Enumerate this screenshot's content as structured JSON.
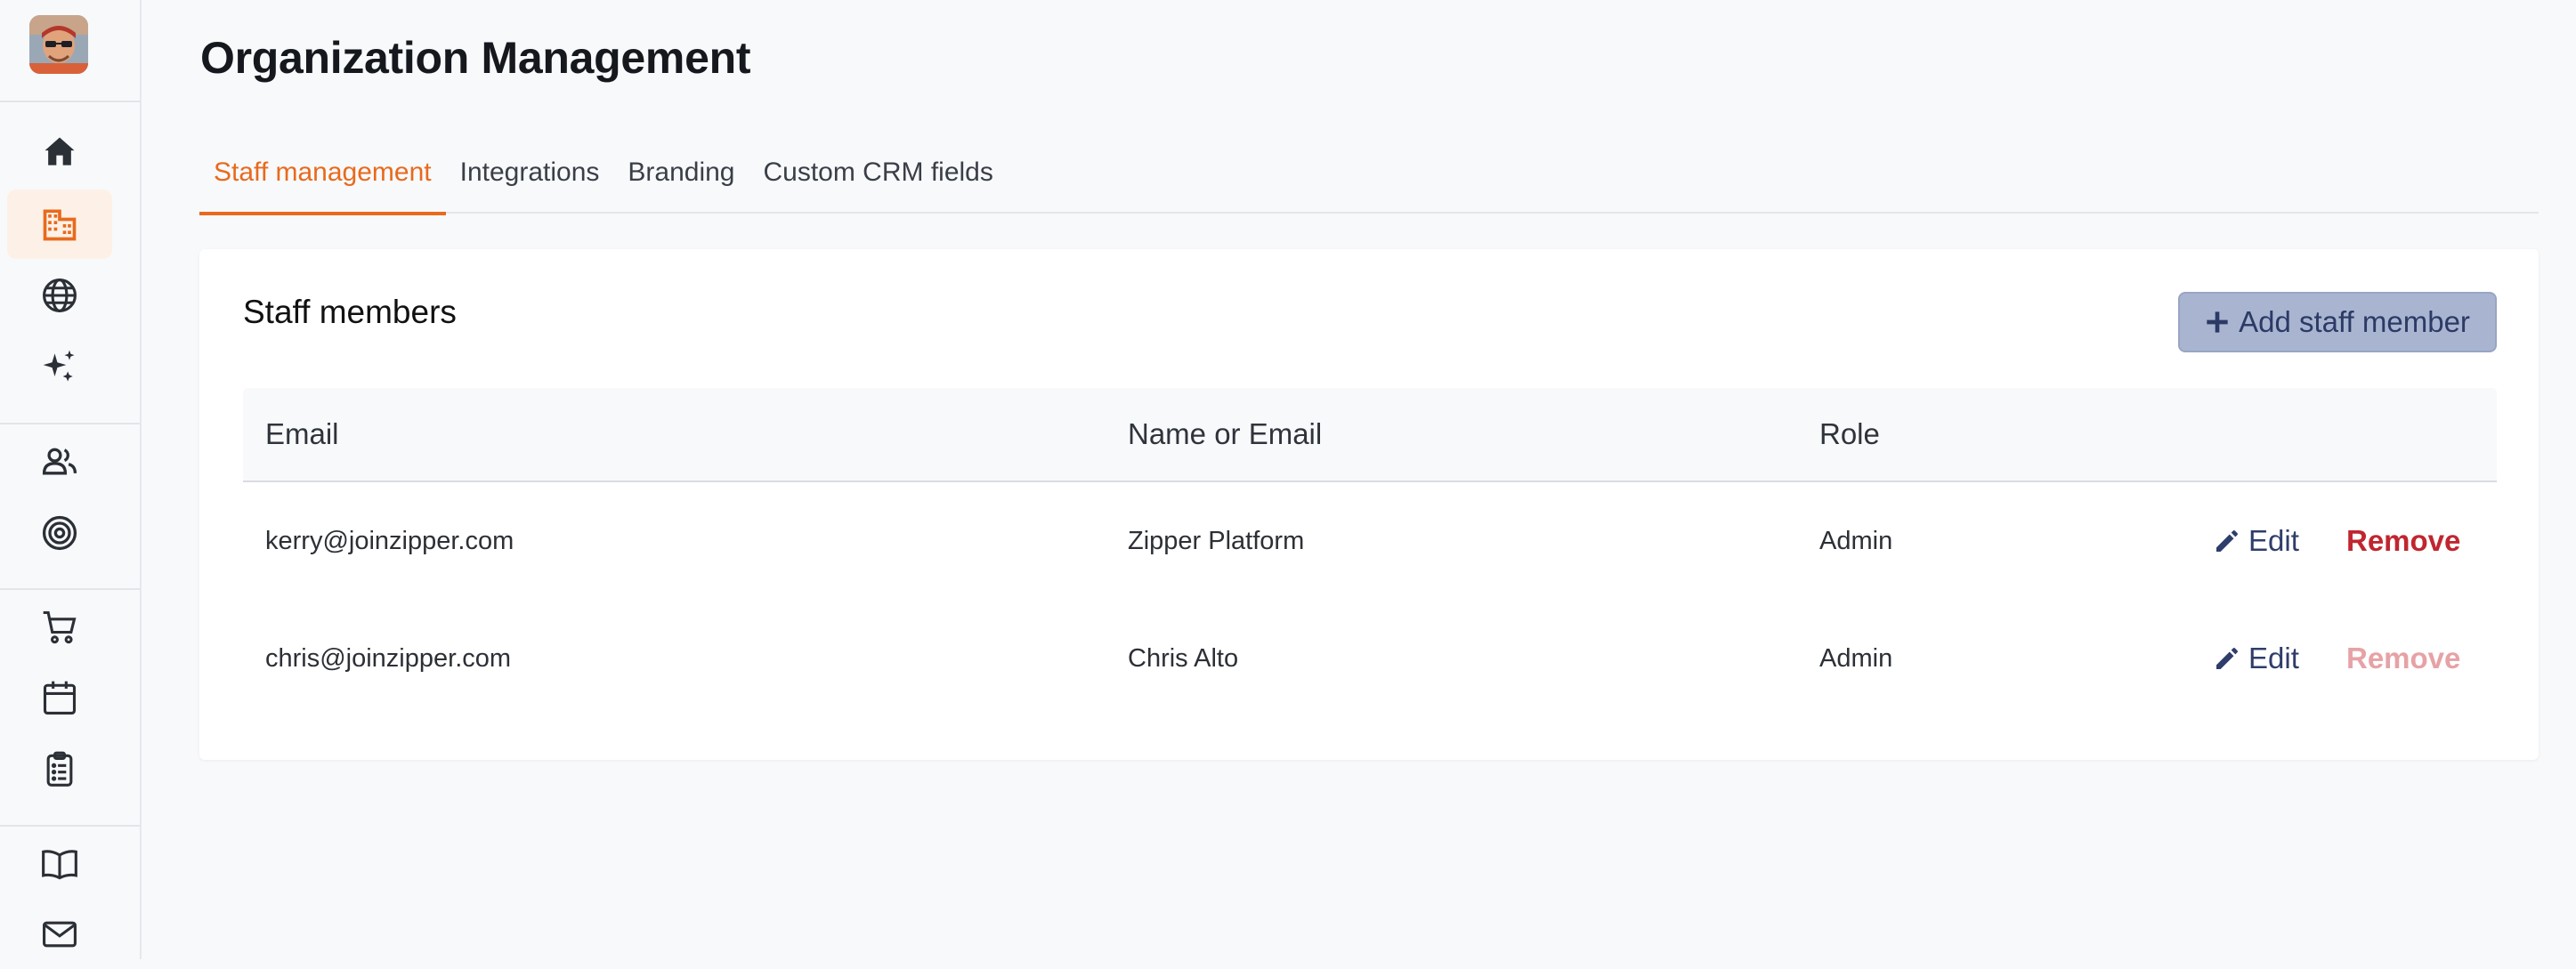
{
  "page": {
    "title": "Organization Management"
  },
  "tabs": [
    {
      "label": "Staff management",
      "active": true
    },
    {
      "label": "Integrations",
      "active": false
    },
    {
      "label": "Branding",
      "active": false
    },
    {
      "label": "Custom CRM fields",
      "active": false
    }
  ],
  "sidebar": {
    "items": [
      {
        "icon": "home-icon"
      },
      {
        "icon": "building-icon",
        "active": true
      },
      {
        "icon": "globe-icon"
      },
      {
        "icon": "sparkles-icon"
      },
      {
        "icon": "people-icon"
      },
      {
        "icon": "target-icon"
      },
      {
        "icon": "cart-icon"
      },
      {
        "icon": "calendar-icon"
      },
      {
        "icon": "clipboard-list-icon"
      },
      {
        "icon": "book-icon"
      },
      {
        "icon": "mail-icon"
      }
    ]
  },
  "staff": {
    "title": "Staff members",
    "add_button_label": "Add staff member",
    "columns": [
      "Email",
      "Name or Email",
      "Role"
    ],
    "rows": [
      {
        "email": "kerry@joinzipper.com",
        "name": "Zipper Platform",
        "role": "Admin",
        "edit_label": "Edit",
        "remove_label": "Remove",
        "remove_enabled": true
      },
      {
        "email": "chris@joinzipper.com",
        "name": "Chris Alto",
        "role": "Admin",
        "edit_label": "Edit",
        "remove_label": "Remove",
        "remove_enabled": false
      }
    ]
  },
  "colors": {
    "accent": "#e86a1d",
    "primary_button": "#a9b5d0",
    "remove_enabled": "#c0262f",
    "remove_disabled": "#e6a2a6"
  }
}
